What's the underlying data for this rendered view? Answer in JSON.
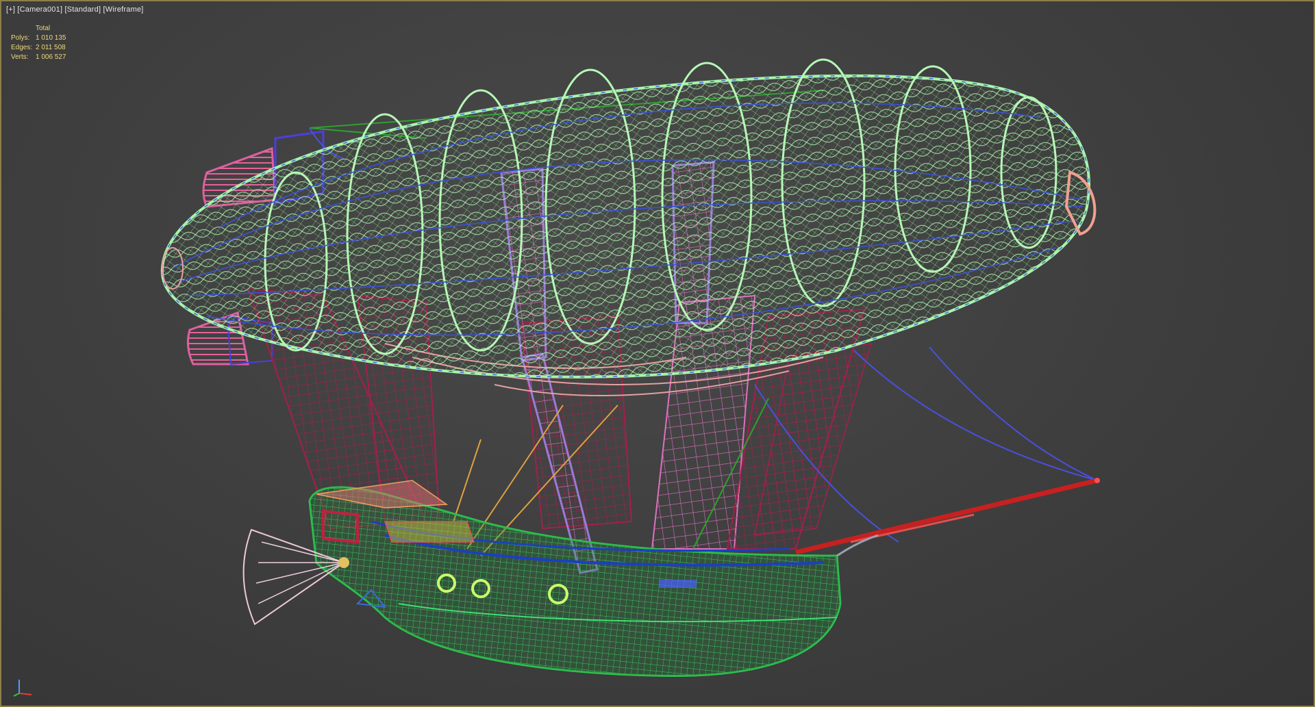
{
  "viewport": {
    "plus_label": "[+]",
    "camera_label": "[Camera001]",
    "shading_label": "[Standard]",
    "mode_label": "[Wireframe]"
  },
  "stats": {
    "header": "Total",
    "rows": [
      {
        "key": "Polys:",
        "value": "1 010 135"
      },
      {
        "key": "Edges:",
        "value": "2 011 508"
      },
      {
        "key": "Verts:",
        "value": "1 006 527"
      }
    ]
  },
  "colors": {
    "viewport_border": "#8c7f4a",
    "stats_text": "#f0d77a",
    "balloon_wire": "#9ff0a0",
    "net_wire": "#a0204a",
    "hull_wire": "#30d060",
    "blue_wire": "#3040e0",
    "bowsprit": "#d02020",
    "fin_wire": "#e060a0"
  },
  "icons": {
    "axis_gizmo": "xyz-axis-icon"
  }
}
